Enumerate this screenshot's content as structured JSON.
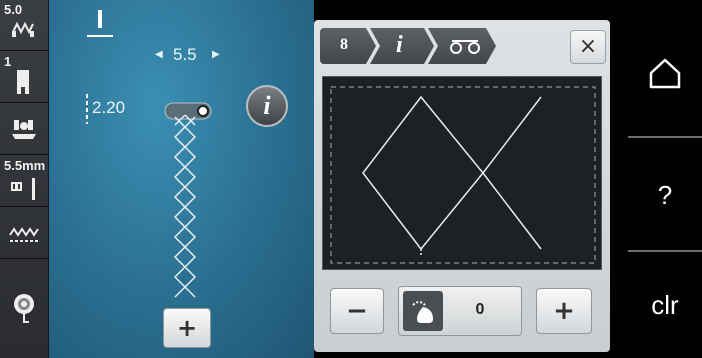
{
  "sidebar": {
    "items": [
      {
        "number": "5.0",
        "icon": "stitch-width-icon"
      },
      {
        "number": "1",
        "icon": "presser-foot-icon"
      },
      {
        "number": "",
        "icon": "feed-dog-icon"
      },
      {
        "number": "5.5mm",
        "icon": "needle-icon"
      },
      {
        "number": "",
        "icon": "stitch-plate-icon"
      },
      {
        "number": "",
        "icon": "bobbin-icon"
      }
    ]
  },
  "stitch": {
    "width_value": "5.5",
    "length_value": "2.20"
  },
  "panel": {
    "crumbs": [
      {
        "label": "8"
      },
      {
        "label": "i"
      },
      {
        "label": "",
        "icon": "balance-icon"
      }
    ],
    "close_label": "×",
    "minus_label": "−",
    "plus_label": "+",
    "balance_value": "0"
  },
  "main": {
    "add_label": "+"
  },
  "rightbar": {
    "home_icon": "home-icon",
    "help_label": "?",
    "clear_label": "clr"
  },
  "colors": {
    "main_blue": "#2a6e90",
    "panel_gray": "#d6d9db",
    "preview_fabric": "#1d2124",
    "sidebar": "#33363a"
  }
}
